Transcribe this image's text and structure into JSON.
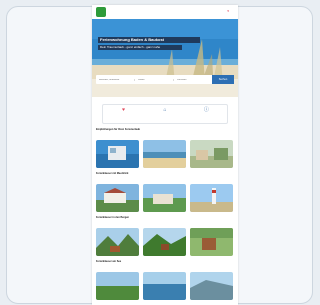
{
  "site": {
    "logo_text": "",
    "nav": {
      "favorites_icon": "heart-icon",
      "items": [
        "",
        ""
      ]
    }
  },
  "hero": {
    "title": "Ferienwohnung Baden & Baukost",
    "subtitle": "Dein Traumurlaub - ganz einfach - ganz nahe",
    "search": {
      "destination": "Reiseziel, Unterkunft",
      "dates": "Datum",
      "guests": "Personen",
      "button": "Suchen"
    }
  },
  "usps": [
    {
      "icon": "heart-icon",
      "label": ""
    },
    {
      "icon": "house-icon",
      "label": ""
    },
    {
      "icon": "info-icon",
      "label": ""
    }
  ],
  "sections": [
    {
      "title": "Empfehlungen für Ihren Ferienurlaub",
      "text": ""
    },
    {
      "title": "Ferienhäuser mit Meerblick",
      "text": ""
    },
    {
      "title": "Ferienhäuser in den Bergen",
      "text": ""
    },
    {
      "title": "Ferienhäuser am See",
      "text": ""
    }
  ],
  "colors": {
    "brand": "#2e9b3a",
    "accent": "#2d6fb4",
    "hero_bar": "#1f3a5c"
  }
}
